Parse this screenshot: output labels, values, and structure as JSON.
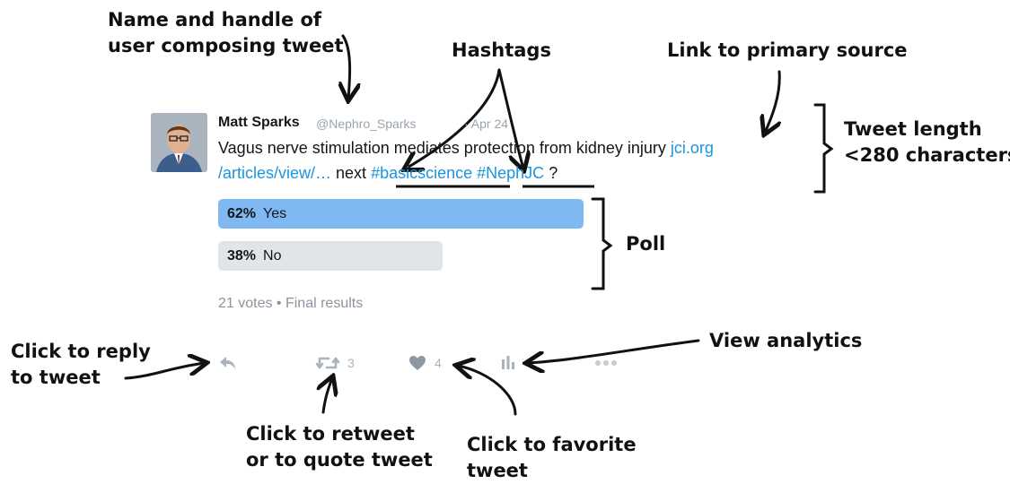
{
  "annotations": {
    "name_handle_line1": "Name and handle of",
    "name_handle_line2": "user composing tweet",
    "hashtags": "Hashtags",
    "link_primary": "Link to primary source",
    "tweet_length_line1": "Tweet length",
    "tweet_length_line2": "<280 characters",
    "poll": "Poll",
    "reply_line1": "Click to reply",
    "reply_line2": "to tweet",
    "analytics": "View analytics",
    "retweet_line1": "Click to retweet",
    "retweet_line2": "or to quote tweet",
    "favorite_line1": "Click to favorite",
    "favorite_line2": "tweet"
  },
  "tweet": {
    "name": "Matt Sparks",
    "handle": "@Nephro_Sparks",
    "date": "· Apr 24",
    "text_line1": "Vagus nerve stimulation mediates protection from kidney injury ",
    "link_part1": "jci.org",
    "link_part2": "/articles/view/…",
    "text_next": " next ",
    "hashtag1": "#basicscience",
    "hashtag2": "#NephJC",
    "text_end": " ?"
  },
  "poll": {
    "options": [
      {
        "pct": "62%",
        "label": "Yes",
        "fraction": 0.62
      },
      {
        "pct": "38%",
        "label": "No",
        "fraction": 0.38
      }
    ],
    "footer": "21 votes • Final results"
  },
  "actions": {
    "retweet_count": "3",
    "like_count": "4"
  },
  "icons": [
    "reply-icon",
    "retweet-icon",
    "heart-icon",
    "analytics-icon",
    "more-icon"
  ],
  "colors": {
    "link": "#1b95e0",
    "poll_winner": "#7fb8f2",
    "poll_other": "#e1e5e9",
    "muted": "#aab2bb"
  }
}
